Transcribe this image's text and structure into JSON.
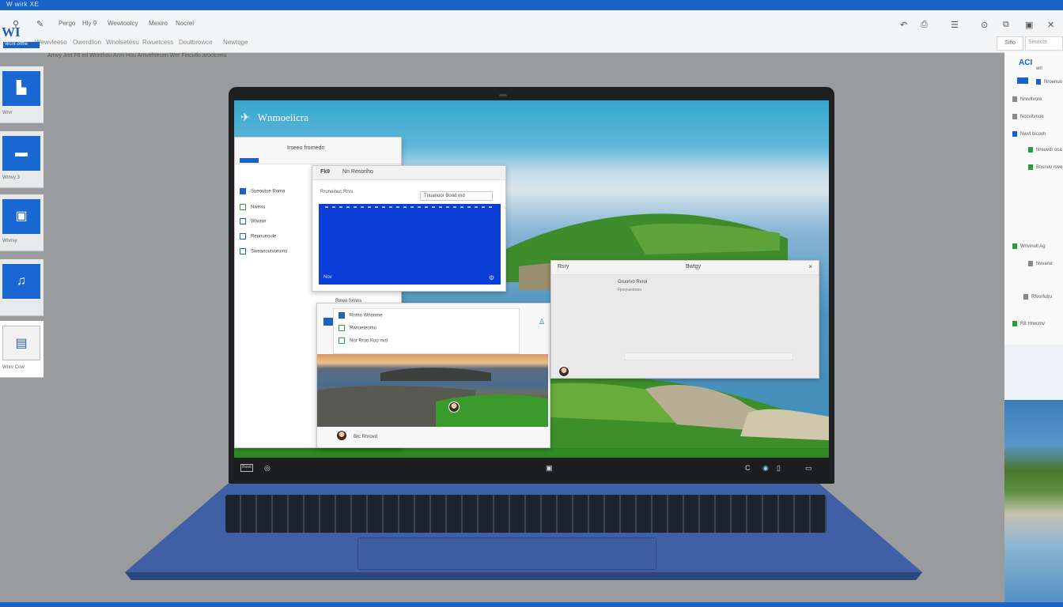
{
  "top_bar": {
    "label": "W wirk XE"
  },
  "toolbar": {
    "menu": [
      "Pergo",
      "Hly 9",
      "Wewtoolcy",
      "Mexiro",
      "Nocrel"
    ],
    "ribbon": [
      "Wewvleeso",
      "Owerdlion",
      "Wnolsetesu",
      "Rwuetcess",
      "Deutbrowce",
      "Newtqge"
    ],
    "zoom_label": "Siffo",
    "search_placeholder": "Seorcte"
  },
  "app": {
    "logo": "WI",
    "badge": "Wcnt orthe"
  },
  "breadcrumb": "Arnvy Jrot F6 ed Wrinthou Arvn Hou Arnvehtecen Wer Fincutlo aroctcenu",
  "left_panel": {
    "thumbs": [
      {
        "glyph": "▙",
        "label": "Wrvr"
      },
      {
        "glyph": "▬",
        "label": "Wrnvy 3"
      },
      {
        "glyph": "▣",
        "label": "Wrvrsy"
      },
      {
        "glyph": "♫",
        "label": ""
      },
      {
        "glyph": "▤",
        "label": "Wnrv Cow"
      }
    ]
  },
  "right_panel": {
    "title": "ACI",
    "sub": "wrl",
    "rows": [
      {
        "icon": "blue",
        "text": "Nroenuo"
      },
      {
        "icon": "grey",
        "text": "Nrevitvore"
      },
      {
        "icon": "grey",
        "text": "Nocvitvnoe"
      },
      {
        "icon": "blue",
        "text": "Nwvt bicovh"
      },
      {
        "icon": "green",
        "text": "Nreuvdr oca"
      },
      {
        "icon": "green",
        "text": "Bosnuv rove"
      },
      {
        "icon": "green",
        "text": "Wrivinutl Ag"
      },
      {
        "icon": "grey",
        "text": "Nvvarur"
      },
      {
        "icon": "grey",
        "text": "Rfvorfutru"
      },
      {
        "icon": "green",
        "text": "R8 Hrwcmv"
      }
    ]
  },
  "laptop": {
    "desktop_title": "Wnmoeiicra",
    "taskbar": {
      "start": "Busd",
      "center_icon": "▣",
      "tray": [
        "C",
        "◉",
        "▯",
        "▭"
      ]
    },
    "explorer": {
      "title": "Irseeo frornedn",
      "nav": [
        "Sueoutue Roma",
        "Nwexu",
        "Wwawr",
        "Reunueoule",
        "Sweanoutvoruinu"
      ]
    },
    "doc_window": {
      "title": "Fk9",
      "tab": "Nn Resoriho",
      "header": "Rrunoinuc Rrvs",
      "field": "Tnuanoor Bood rnd",
      "footer_left": "Nov",
      "footer_caption": "Rewo fomns"
    },
    "photo_window": {
      "list": [
        "Rnmo Wrionme",
        "Rwroeteomo",
        "Nor Rruo Kuo nvd"
      ],
      "caption": "Brc Rnrovd"
    },
    "dialog": {
      "title": "Rsry",
      "path": "Bwtgy",
      "heading": "Gruorvo Rvrol",
      "sub": "Fjneyuevtoeu"
    }
  },
  "colors": {
    "accent": "#1a62c6",
    "doc_blue": "#0a3ed6",
    "laptop_body": "#3f5fa6"
  }
}
